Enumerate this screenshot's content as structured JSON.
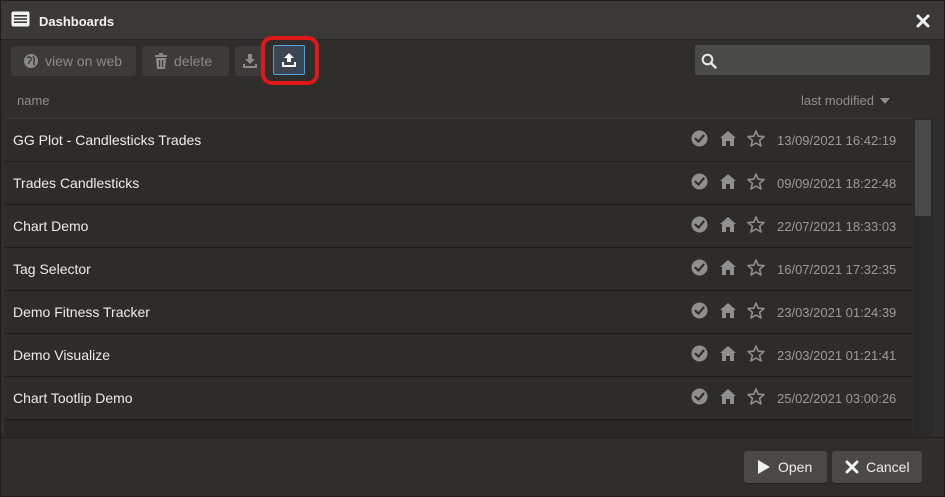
{
  "window": {
    "title": "Dashboards"
  },
  "toolbar": {
    "view_on_web_label": "view on web",
    "delete_label": "delete"
  },
  "columns": {
    "name": "name",
    "last_modified": "last modified"
  },
  "rows": [
    {
      "name": "GG Plot - Candlesticks Trades",
      "modified": "13/09/2021 16:42:19"
    },
    {
      "name": "Trades Candlesticks",
      "modified": "09/09/2021 18:22:48"
    },
    {
      "name": "Chart Demo",
      "modified": "22/07/2021 18:33:03"
    },
    {
      "name": "Tag Selector",
      "modified": "16/07/2021 17:32:35"
    },
    {
      "name": "Demo Fitness Tracker",
      "modified": "23/03/2021 01:24:39"
    },
    {
      "name": "Demo Visualize",
      "modified": "23/03/2021 01:21:41"
    },
    {
      "name": "Chart Tootlip Demo",
      "modified": "25/02/2021 03:00:26"
    }
  ],
  "footer": {
    "open_label": "Open",
    "cancel_label": "Cancel"
  },
  "colors": {
    "highlight": "#e01818",
    "accent": "#4da3e0"
  }
}
